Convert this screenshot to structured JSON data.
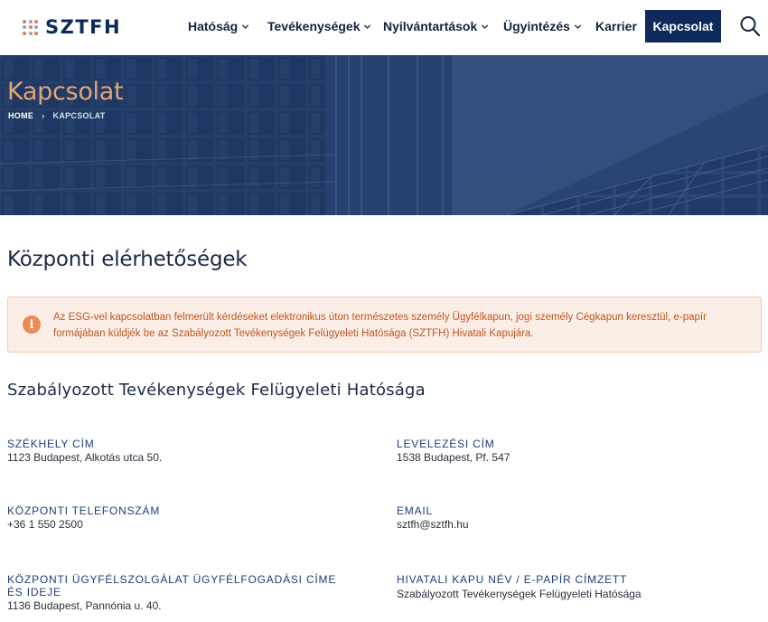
{
  "brand": {
    "name": "SZTFH",
    "dot_colors": [
      "#e57b4a",
      "#8aa2c8",
      "#e57b4a",
      "#8aa2c8",
      "#e57b4a",
      "#8aa2c8",
      "#e57b4a",
      "#8aa2c8",
      "#e57b4a"
    ]
  },
  "nav": {
    "items": [
      {
        "label": "Hatóság",
        "has_dropdown": true
      },
      {
        "label": "Tevékenységek",
        "has_dropdown": true
      },
      {
        "label": "Nyilvántartások",
        "has_dropdown": true
      },
      {
        "label": "Ügyintézés",
        "has_dropdown": true
      },
      {
        "label": "Karrier",
        "has_dropdown": false
      }
    ],
    "cta_label": "Kapcsolat",
    "search_icon": "search-icon"
  },
  "hero": {
    "title": "Kapcsolat",
    "breadcrumb": [
      "HOME",
      "KAPCSOLAT"
    ],
    "breadcrumb_separator": "›"
  },
  "main": {
    "section_title": "Központi elérhetőségek",
    "alert": {
      "icon": "info-icon",
      "text": "Az ESG-vel kapcsolatban felmerült kérdéseket elektronikus úton természetes személy Ügyfélkapun, jogi személy Cégkapun keresztül, e-papír formájában küldjék be az Szabályozott Tevékenységek Felügyeleti Hatósága (SZTFH) Hivatali Kapujára."
    },
    "org_title": "Szabályozott Tevékenységek Felügyeleti Hatósága",
    "contacts": [
      {
        "label": "SZÉKHELY CÍM",
        "value": "1123 Budapest, Alkotás utca 50."
      },
      {
        "label": "LEVELEZÉSI CÍM",
        "value": "1538 Budapest, Pf. 547"
      },
      {
        "label": "KÖZPONTI TELEFONSZÁM",
        "value": "+36 1 550 2500"
      },
      {
        "label": "EMAIL",
        "value": "sztfh@sztfh.hu"
      },
      {
        "label": "KÖZPONTI ÜGYFÉLSZOLGÁLAT ÜGYFÉLFOGADÁSI CÍME ÉS IDEJE",
        "value": "1136 Budapest, Pannónia u. 40."
      },
      {
        "label": "HIVATALI KAPU NÉV / E-PAPÍR CÍMZETT",
        "value": "Szabályozott Tevékenységek Felügyeleti Hatósága"
      }
    ]
  },
  "colors": {
    "primary": "#0d2a5b",
    "accent_orange": "#e4a575",
    "alert_bg": "#fbeee6",
    "alert_text": "#c2551f"
  }
}
